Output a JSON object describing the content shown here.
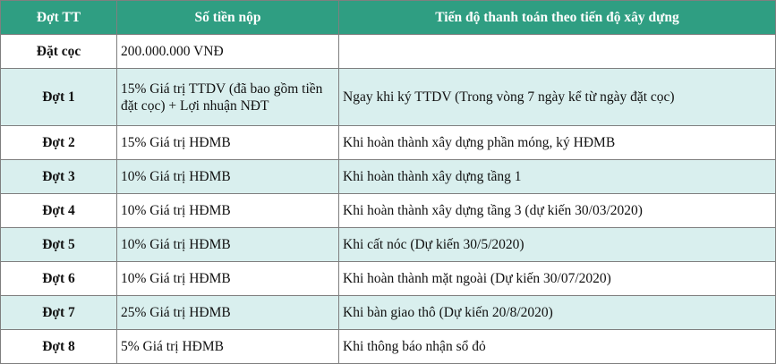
{
  "table": {
    "headers": [
      "Đợt TT",
      "Số tiền nộp",
      "Tiến độ thanh toán theo tiến độ xây dựng"
    ],
    "rows": [
      {
        "phase": "Đặt cọc",
        "amount": "200.000.000 VNĐ",
        "progress": ""
      },
      {
        "phase": "Đợt 1",
        "amount": "15% Giá trị TTDV (đã bao gồm tiền đặt cọc) + Lợi nhuận NĐT",
        "progress": "Ngay khi ký TTDV (Trong vòng 7 ngày kể từ ngày đặt cọc)"
      },
      {
        "phase": "Đợt 2",
        "amount": "15% Giá trị HĐMB",
        "progress": "Khi hoàn thành xây dựng phần móng, ký HĐMB"
      },
      {
        "phase": "Đợt 3",
        "amount": "10% Giá trị HĐMB",
        "progress": "Khi hoàn thành xây dựng tầng 1"
      },
      {
        "phase": "Đợt 4",
        "amount": "10% Giá trị HĐMB",
        "progress": "Khi hoàn thành xây dựng tầng 3 (dự kiến 30/03/2020)"
      },
      {
        "phase": "Đợt 5",
        "amount": "10% Giá trị HĐMB",
        "progress": "Khi cất nóc (Dự kiến 30/5/2020)"
      },
      {
        "phase": "Đợt 6",
        "amount": "10% Giá trị HĐMB",
        "progress": "Khi hoàn thành mặt ngoài (Dự kiến 30/07/2020)"
      },
      {
        "phase": "Đợt 7",
        "amount": "25% Giá trị HĐMB",
        "progress": "Khi bàn giao thô (Dự kiến 20/8/2020)"
      },
      {
        "phase": "Đợt 8",
        "amount": "5% Giá trị HĐMB",
        "progress": "Khi thông báo nhận sổ đỏ"
      }
    ]
  },
  "colors": {
    "header_bg": "#2f9e82",
    "header_text": "#ffffff",
    "stripe_bg": "#d9efee",
    "border": "#7f7f7f"
  }
}
